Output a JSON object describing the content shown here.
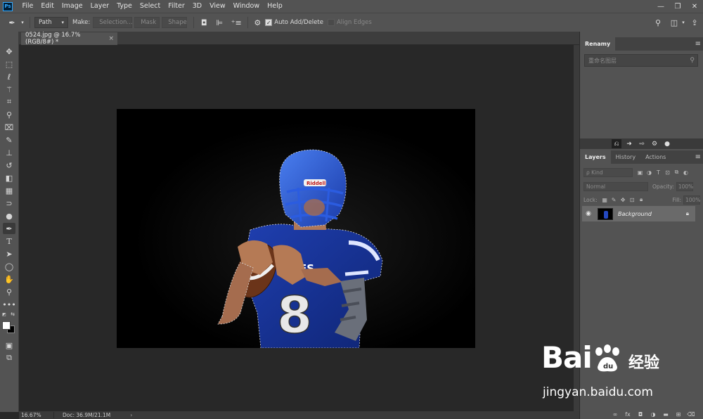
{
  "app": {
    "logo_text": "Ps"
  },
  "menu": [
    "File",
    "Edit",
    "Image",
    "Layer",
    "Type",
    "Select",
    "Filter",
    "3D",
    "View",
    "Window",
    "Help"
  ],
  "window_controls": {
    "minimize": "—",
    "restore": "❐",
    "close": "✕"
  },
  "options": {
    "tool_mode": "Path",
    "make_label": "Make:",
    "selection_btn": "Selection...",
    "mask_btn": "Mask",
    "shape_btn": "Shape",
    "auto_add_delete": "Auto Add/Delete",
    "align_edges": "Align Edges"
  },
  "document": {
    "tab_title": "0524.jpg @ 16.7% (RGB/8#) *",
    "tab_close": "×"
  },
  "status": {
    "zoom": "16.67%",
    "doc_size": "Doc: 36.9M/21.1M",
    "arrow": "›"
  },
  "renamy": {
    "tab": "Renamy",
    "search_placeholder": "重命名图层"
  },
  "layers_panel": {
    "tabs": [
      "Layers",
      "History",
      "Actions"
    ],
    "kind_label": "ρ Kind",
    "blend_mode": "Normal",
    "opacity_label": "Opacity:",
    "opacity_value": "100%",
    "lock_label": "Lock:",
    "fill_label": "Fill:",
    "fill_value": "100%",
    "layer_name": "Background"
  },
  "watermark": {
    "brand": "Bai",
    "brand2": "经验",
    "site": "jingyan.baidu.com"
  }
}
